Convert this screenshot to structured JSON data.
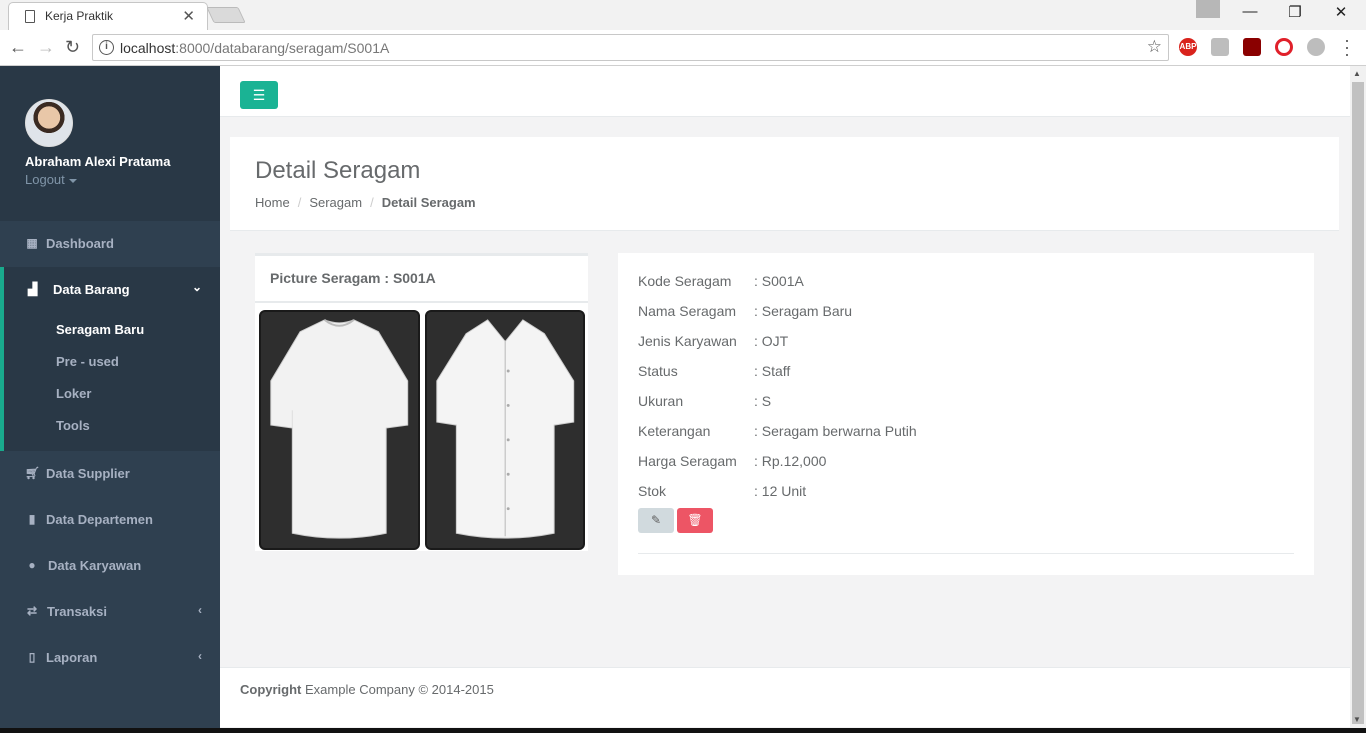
{
  "browser": {
    "tab_title": "Kerja Praktik",
    "url_host": "localhost",
    "url_path": ":8000/databarang/seragam/S001A",
    "extensions": [
      "ABP",
      "drive",
      "acrobat",
      "opera",
      "ghostery"
    ]
  },
  "sidebar": {
    "user_name": "Abraham Alexi Pratama",
    "logout_label": "Logout",
    "items": [
      {
        "label": "Dashboard",
        "icon": "th-large-icon"
      },
      {
        "label": "Data Barang",
        "icon": "bar-chart-icon",
        "active": true
      },
      {
        "label": "Data Supplier",
        "icon": "shopping-cart-icon"
      },
      {
        "label": "Data Departemen",
        "icon": "building-icon"
      },
      {
        "label": "Data Karyawan",
        "icon": "users-icon"
      },
      {
        "label": "Transaksi",
        "icon": "exchange-icon"
      },
      {
        "label": "Laporan",
        "icon": "file-pdf-icon"
      }
    ],
    "sub_items": [
      "Seragam Baru",
      "Pre - used",
      "Loker",
      "Tools"
    ]
  },
  "page": {
    "title": "Detail Seragam",
    "breadcrumb": [
      "Home",
      "Seragam",
      "Detail Seragam"
    ]
  },
  "picture": {
    "title": "Picture Seragam : S001A"
  },
  "details": [
    {
      "key": "Kode Seragam",
      "value": ": S001A"
    },
    {
      "key": "Nama Seragam",
      "value": ": Seragam Baru"
    },
    {
      "key": "Jenis Karyawan",
      "value": ": OJT"
    },
    {
      "key": "Status",
      "value": ": Staff"
    },
    {
      "key": "Ukuran",
      "value": ": S"
    },
    {
      "key": "Keterangan",
      "value": ": Seragam berwarna Putih"
    },
    {
      "key": "Harga Seragam",
      "value": ": Rp.12,000"
    },
    {
      "key": "Stok",
      "value": ": 12 Unit"
    }
  ],
  "footer": {
    "copyright_label": "Copyright",
    "company": "Example Company © 2014-2015"
  },
  "colors": {
    "accent": "#1ab394",
    "sidebar": "#2f4050",
    "danger": "#ed5565"
  }
}
